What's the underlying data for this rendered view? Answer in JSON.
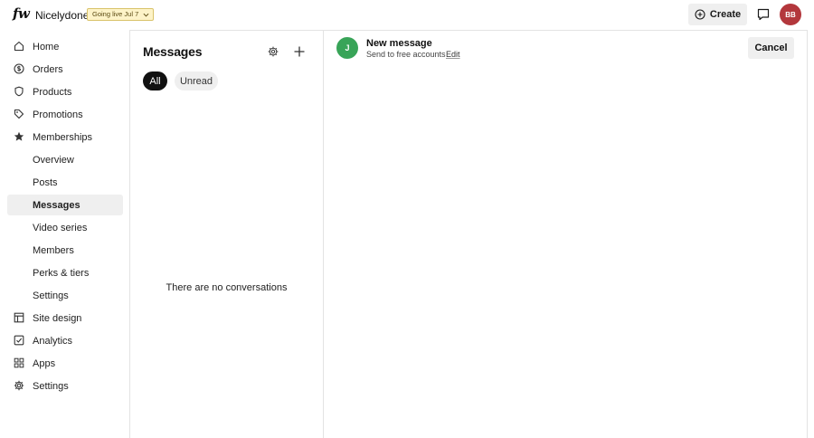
{
  "app": {
    "logo": "fw",
    "site_name": "Nicelydone",
    "status_badge": "Going live Jul 7",
    "create_label": "Create",
    "user_initials": "BB"
  },
  "sidebar": {
    "items": [
      {
        "label": "Home",
        "icon": "home-icon"
      },
      {
        "label": "Orders",
        "icon": "dollar-circle-icon"
      },
      {
        "label": "Products",
        "icon": "shield-icon"
      },
      {
        "label": "Promotions",
        "icon": "tag-icon"
      },
      {
        "label": "Memberships",
        "icon": "star-icon"
      },
      {
        "label": "Overview"
      },
      {
        "label": "Posts"
      },
      {
        "label": "Messages",
        "active": true
      },
      {
        "label": "Video series"
      },
      {
        "label": "Members"
      },
      {
        "label": "Perks & tiers"
      },
      {
        "label": "Settings"
      },
      {
        "label": "Site design",
        "icon": "layout-icon"
      },
      {
        "label": "Analytics",
        "icon": "check-square-icon"
      },
      {
        "label": "Apps",
        "icon": "grid-icon"
      },
      {
        "label": "Settings",
        "icon": "gear-icon"
      }
    ]
  },
  "messages": {
    "title": "Messages",
    "filters": [
      "All",
      "Unread"
    ],
    "active_filter": "All",
    "empty_text": "There are no conversations"
  },
  "compose": {
    "avatar_initial": "J",
    "title": "New message",
    "subtitle": "Send to free accounts",
    "edit_label": "Edit",
    "cancel_label": "Cancel"
  }
}
